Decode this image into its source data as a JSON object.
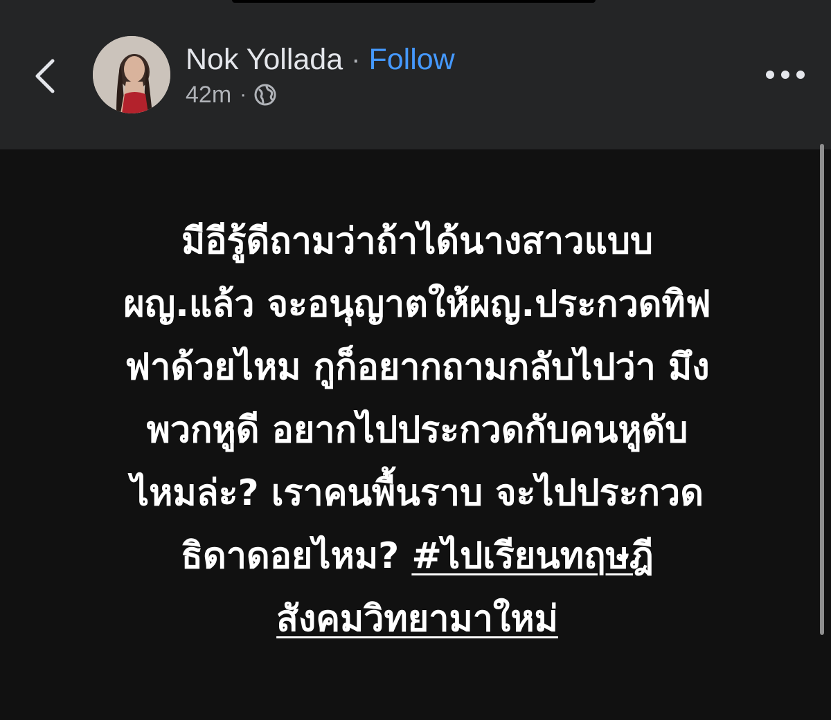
{
  "header": {
    "author_name": "Nok Yollada",
    "separator": "·",
    "follow_label": "Follow",
    "timestamp": "42m",
    "meta_separator": "·",
    "audience_icon": "globe-icon",
    "back_icon": "chevron-left-icon",
    "more_icon": "more-horizontal-icon"
  },
  "post": {
    "lines": [
      "มีอีรู้ดีถามว่าถ้าได้นางสาวแบบ",
      "ผญ.แล้ว จะอนุญาตให้ผญ.ประกวดทิฟ",
      "ฟาด้วยไหม กูก็อยากถามกลับไปว่า มึง",
      "พวกหูดี อยากไปประกวดกับคนหูดับ",
      "ไหมล่ะ? เราคนพื้นราบ จะไปประกวด"
    ],
    "line6_prefix": "ธิดาดอยไหม? ",
    "hashtag_part1": "#ไปเรียนทฤษฎี",
    "hashtag_part2": "สังคมวิทยามาใหม่"
  },
  "colors": {
    "header_bg": "#242526",
    "body_bg": "#111111",
    "link_blue": "#4599ff",
    "text_primary": "#e4e6eb",
    "text_secondary": "#b0b3b8"
  }
}
